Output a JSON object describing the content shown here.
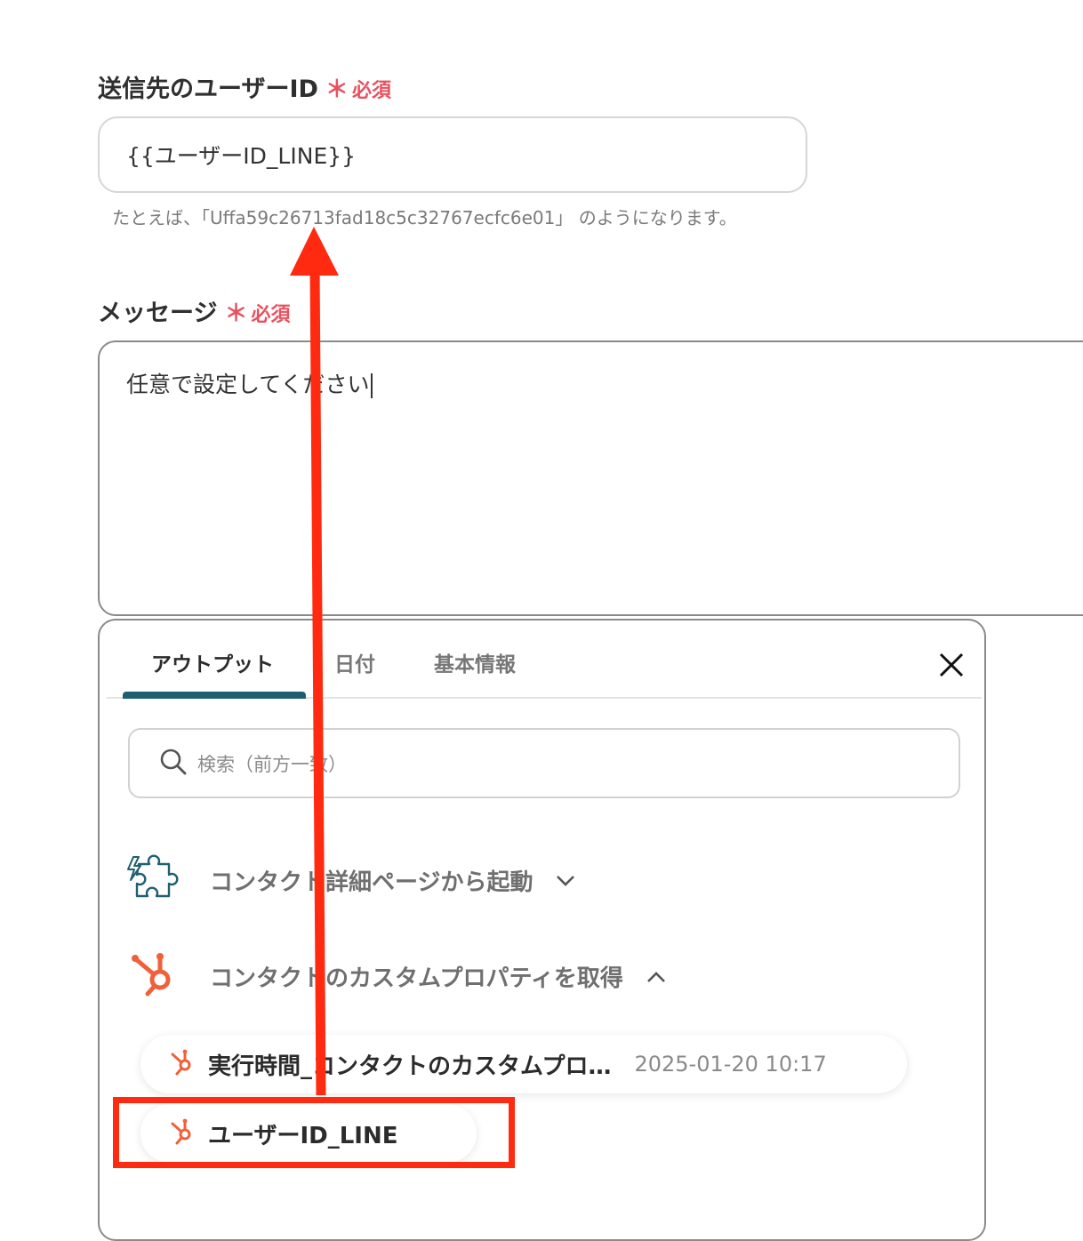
{
  "user_id_field": {
    "label": "送信先のユーザーID",
    "required_mark": "＊",
    "required_text": "必須",
    "value": "{{ユーザーID_LINE}}",
    "hint": "たとえば、「Uffa59c26713fad18c5c32767ecfc6e01」 のようになります。"
  },
  "message_field": {
    "label": "メッセージ",
    "required_mark": "＊",
    "required_text": "必須",
    "value": "任意で設定してください"
  },
  "panel": {
    "tabs": [
      {
        "label": "アウトプット",
        "active": true
      },
      {
        "label": "日付",
        "active": false
      },
      {
        "label": "基本情報",
        "active": false
      }
    ],
    "close_icon": "close-icon",
    "search": {
      "icon": "search-icon",
      "placeholder": "検索（前方一致）"
    },
    "groups": [
      {
        "label": "コンタクト詳細ページから起動",
        "icon": "puzzle-bolt-icon",
        "expanded": false
      },
      {
        "label": "コンタクトのカスタムプロパティを取得",
        "icon": "hubspot-icon",
        "expanded": true
      }
    ],
    "items": [
      {
        "name": "実行時間_コンタクトのカスタムプロ…",
        "value": "2025-01-20 10:17",
        "icon": "hubspot-icon"
      },
      {
        "name": "ユーザーID_LINE",
        "value": "",
        "icon": "hubspot-icon"
      }
    ]
  },
  "colors": {
    "required": "#e8515f",
    "tab_active_underline": "#1d5f70",
    "hubspot_orange": "#f0613a",
    "annotation_red": "#ff2a0f"
  }
}
